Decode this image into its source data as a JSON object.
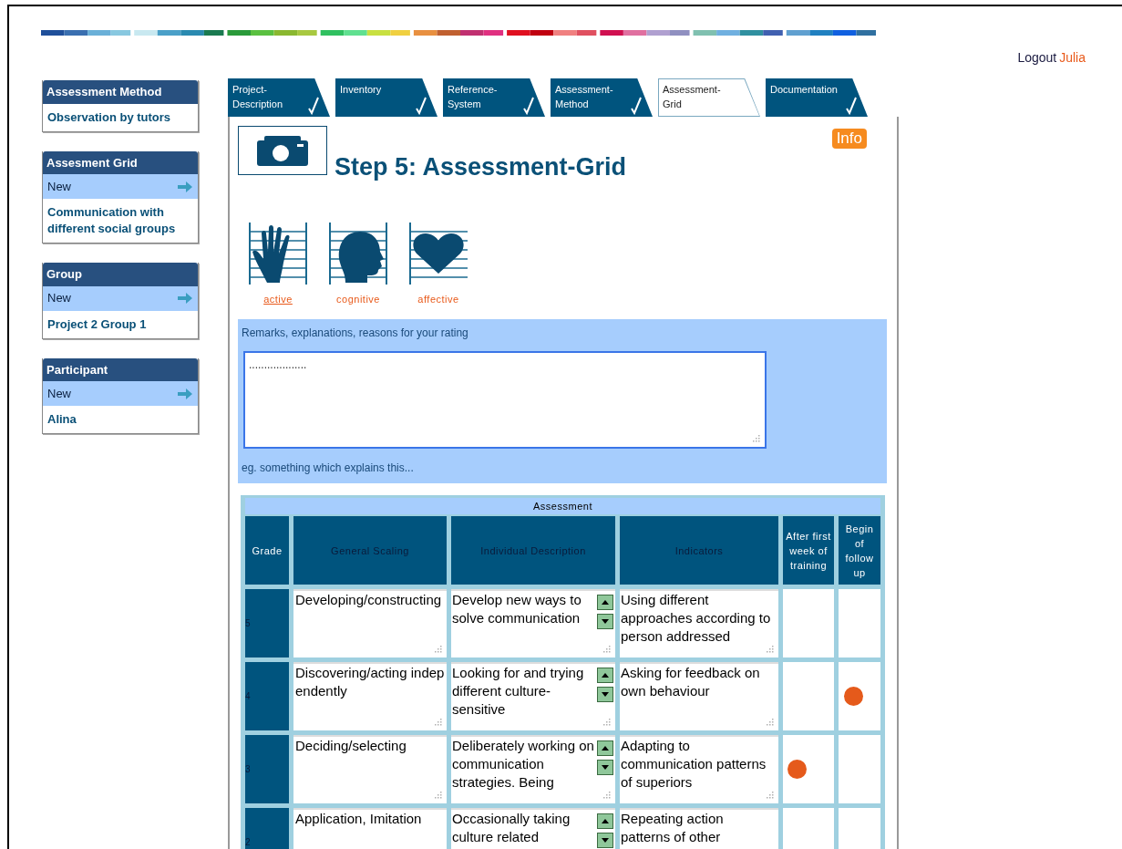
{
  "header": {
    "logout": "Logout",
    "user": "Julia"
  },
  "sidebar": [
    {
      "title": "Assessment Method",
      "items": [
        "Observation by tutors"
      ]
    },
    {
      "title": "Assesment Grid",
      "new": "New",
      "items": [
        "Communication with different social groups"
      ]
    },
    {
      "title": "Group",
      "new": "New",
      "items": [
        "Project 2 Group 1"
      ]
    },
    {
      "title": "Participant",
      "new": "New",
      "items": [
        "Alina"
      ]
    }
  ],
  "tabs": [
    {
      "label": "Project-\nDescription",
      "selected": false,
      "done": true
    },
    {
      "label": "Inventory",
      "selected": false,
      "done": true
    },
    {
      "label": "Reference-\nSystem",
      "selected": false,
      "done": true
    },
    {
      "label": "Assessment-\nMethod",
      "selected": false,
      "done": true
    },
    {
      "label": "Assessment-\nGrid",
      "selected": true,
      "done": false
    },
    {
      "label": "Documentation",
      "selected": false,
      "done": true
    }
  ],
  "step_title": "Step 5: Assessment-Grid",
  "info": "Info",
  "domains": [
    {
      "kind": "hand",
      "label": "active",
      "selected": true
    },
    {
      "kind": "head",
      "label": "cognitive",
      "selected": false
    },
    {
      "kind": "heart",
      "label": "affective",
      "selected": false
    }
  ],
  "remarks": {
    "label": "Remarks, explanations, reasons for your rating",
    "value": "...................",
    "hint": "eg. something which explains this..."
  },
  "table": {
    "title": "Assessment",
    "columns": [
      "Grade",
      "General Scaling",
      "Individual Description",
      "Indicators",
      "After first week of training",
      "Begin of follow up"
    ],
    "rows": [
      {
        "grade": "5",
        "scaling": "Developing/constructing",
        "description": "Develop new ways to solve communication",
        "indicators": "Using different approaches according to person addressed",
        "after_first_week": false,
        "begin_follow_up": false
      },
      {
        "grade": "4",
        "scaling": "Discovering/acting independently",
        "description": "Looking for and trying different culture-sensitive",
        "indicators": "Asking for feedback on own behaviour",
        "after_first_week": false,
        "begin_follow_up": true
      },
      {
        "grade": "3",
        "scaling": "Deciding/selecting",
        "description": "Deliberately working on communication strategies. Being",
        "indicators": "Adapting to communication patterns of superiors",
        "after_first_week": true,
        "begin_follow_up": false
      },
      {
        "grade": "2",
        "scaling": "Application, Imitation",
        "description": "Occasionally taking culture related",
        "indicators": "Repeating action patterns of other",
        "after_first_week": false,
        "begin_follow_up": false
      }
    ]
  }
}
